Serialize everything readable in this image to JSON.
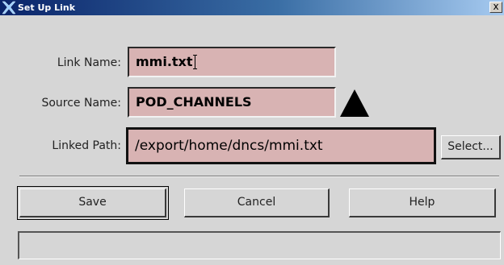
{
  "window": {
    "title": "Set Up Link",
    "close_label": "x",
    "icon": "x-window-icon"
  },
  "form": {
    "link_name": {
      "label": "Link Name:",
      "value": "mmi.txt"
    },
    "source_name": {
      "label": "Source Name:",
      "value": "POD_CHANNELS"
    },
    "linked_path": {
      "label": "Linked Path:",
      "value": "/export/home/dncs/mmi.txt"
    }
  },
  "buttons": {
    "select": "Select...",
    "save": "Save",
    "cancel": "Cancel",
    "help": "Help"
  },
  "status_text": "",
  "colors": {
    "field_bg": "#d8b3b3",
    "window_bg": "#d6d6d6",
    "titlebar_start": "#0a246a",
    "titlebar_end": "#a6caf0"
  }
}
